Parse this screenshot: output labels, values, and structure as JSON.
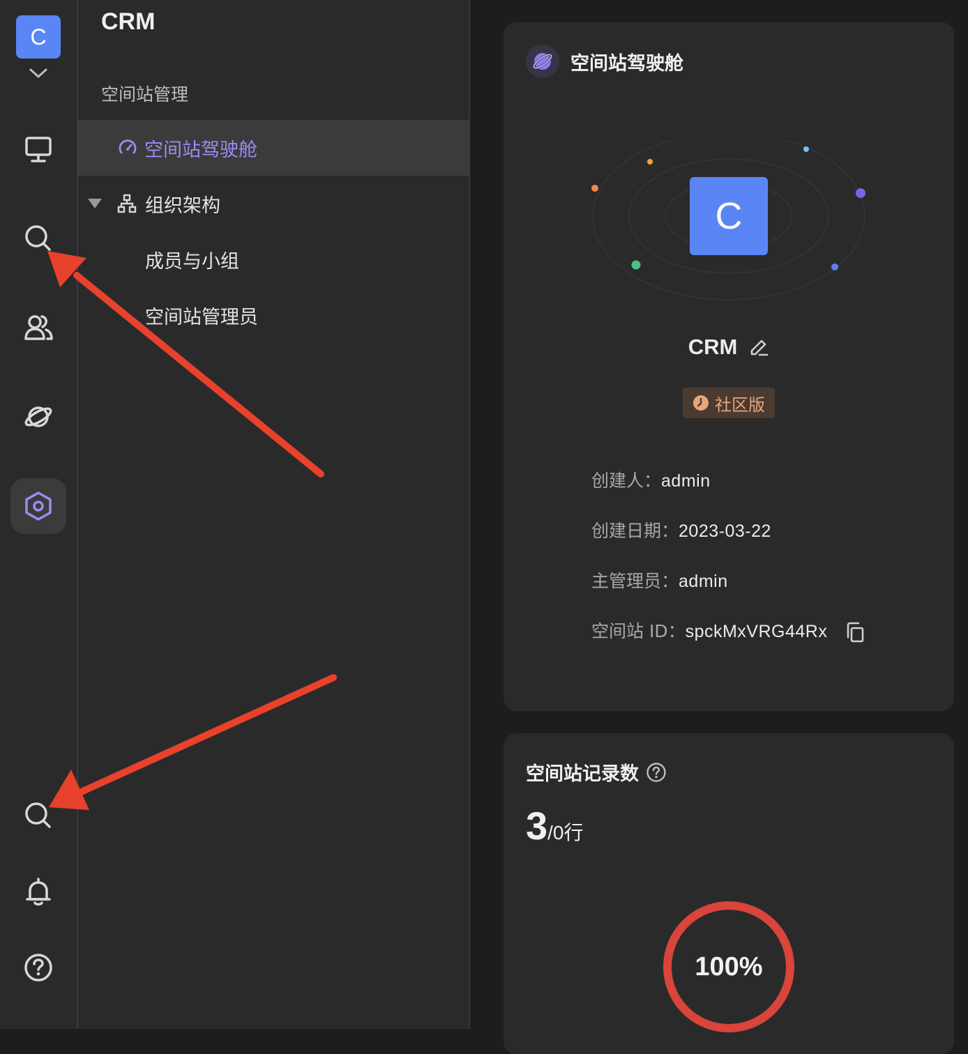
{
  "rail": {
    "avatar_letter": "C",
    "icons": [
      "chevron-down-icon",
      "monitor-icon",
      "search-icon",
      "users-icon",
      "planet-icon",
      "hexagon-settings-icon",
      "search-icon",
      "bell-icon",
      "help-icon"
    ]
  },
  "nav": {
    "title": "CRM",
    "section": "空间站管理",
    "items": [
      {
        "label": "空间站驾驶舱",
        "icon": "dashboard-gauge-icon",
        "active": true
      },
      {
        "label": "组织架构",
        "icon": "org-tree-icon",
        "expanded": true
      },
      {
        "label": "成员与小组"
      },
      {
        "label": "空间站管理员"
      }
    ]
  },
  "cockpit": {
    "title": "空间站驾驶舱",
    "avatar_letter": "C",
    "space_name": "CRM",
    "edition": "社区版",
    "info": {
      "creator_label": "创建人：",
      "creator": "admin",
      "date_label": "创建日期：",
      "date": "2023-03-22",
      "admin_label": "主管理员：",
      "admin": "admin",
      "id_label": "空间站 ID：",
      "id": "spckMxVRG44Rx"
    }
  },
  "records": {
    "title": "空间站记录数",
    "count": "3",
    "total": "/0行",
    "percent_label": "100%",
    "percent": 1.0
  },
  "colors": {
    "accent": "#9b8cf3",
    "avatar": "#5a86f5",
    "annotation_arrow": "#e8412c",
    "ring": "#d9443b",
    "edition_text": "#e6a77a"
  }
}
